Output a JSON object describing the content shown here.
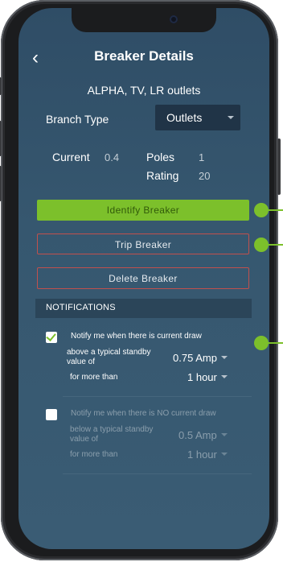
{
  "header": {
    "back_icon": "chevron-left-icon",
    "back_glyph": "‹",
    "title": "Breaker Details"
  },
  "breaker": {
    "name": "ALPHA, TV, LR outlets",
    "branch_type_label": "Branch Type",
    "branch_type_value": "Outlets",
    "current_label": "Current",
    "current_value": "0.4",
    "poles_label": "Poles",
    "poles_value": "1",
    "rating_label": "Rating",
    "rating_value": "20"
  },
  "actions": {
    "identify_label": "Identify Breaker",
    "trip_label": "Trip Breaker",
    "delete_label": "Delete Breaker"
  },
  "notifications": {
    "header": "NOTIFICATIONS",
    "current_draw": {
      "checked": true,
      "title": "Notify me when there is current draw",
      "threshold_label": "above a typical standby value of",
      "threshold_value": "0.75 Amp",
      "duration_label": "for more than",
      "duration_value": "1 hour"
    },
    "no_current_draw": {
      "checked": false,
      "title": "Notify me when there is NO current draw",
      "threshold_label": "below a typical standby value of",
      "threshold_value": "0.5 Amp",
      "duration_label": "for more than",
      "duration_value": "1 hour"
    }
  },
  "colors": {
    "accent": "#7cc02b",
    "danger": "#c0504d",
    "background": "#33536b"
  }
}
